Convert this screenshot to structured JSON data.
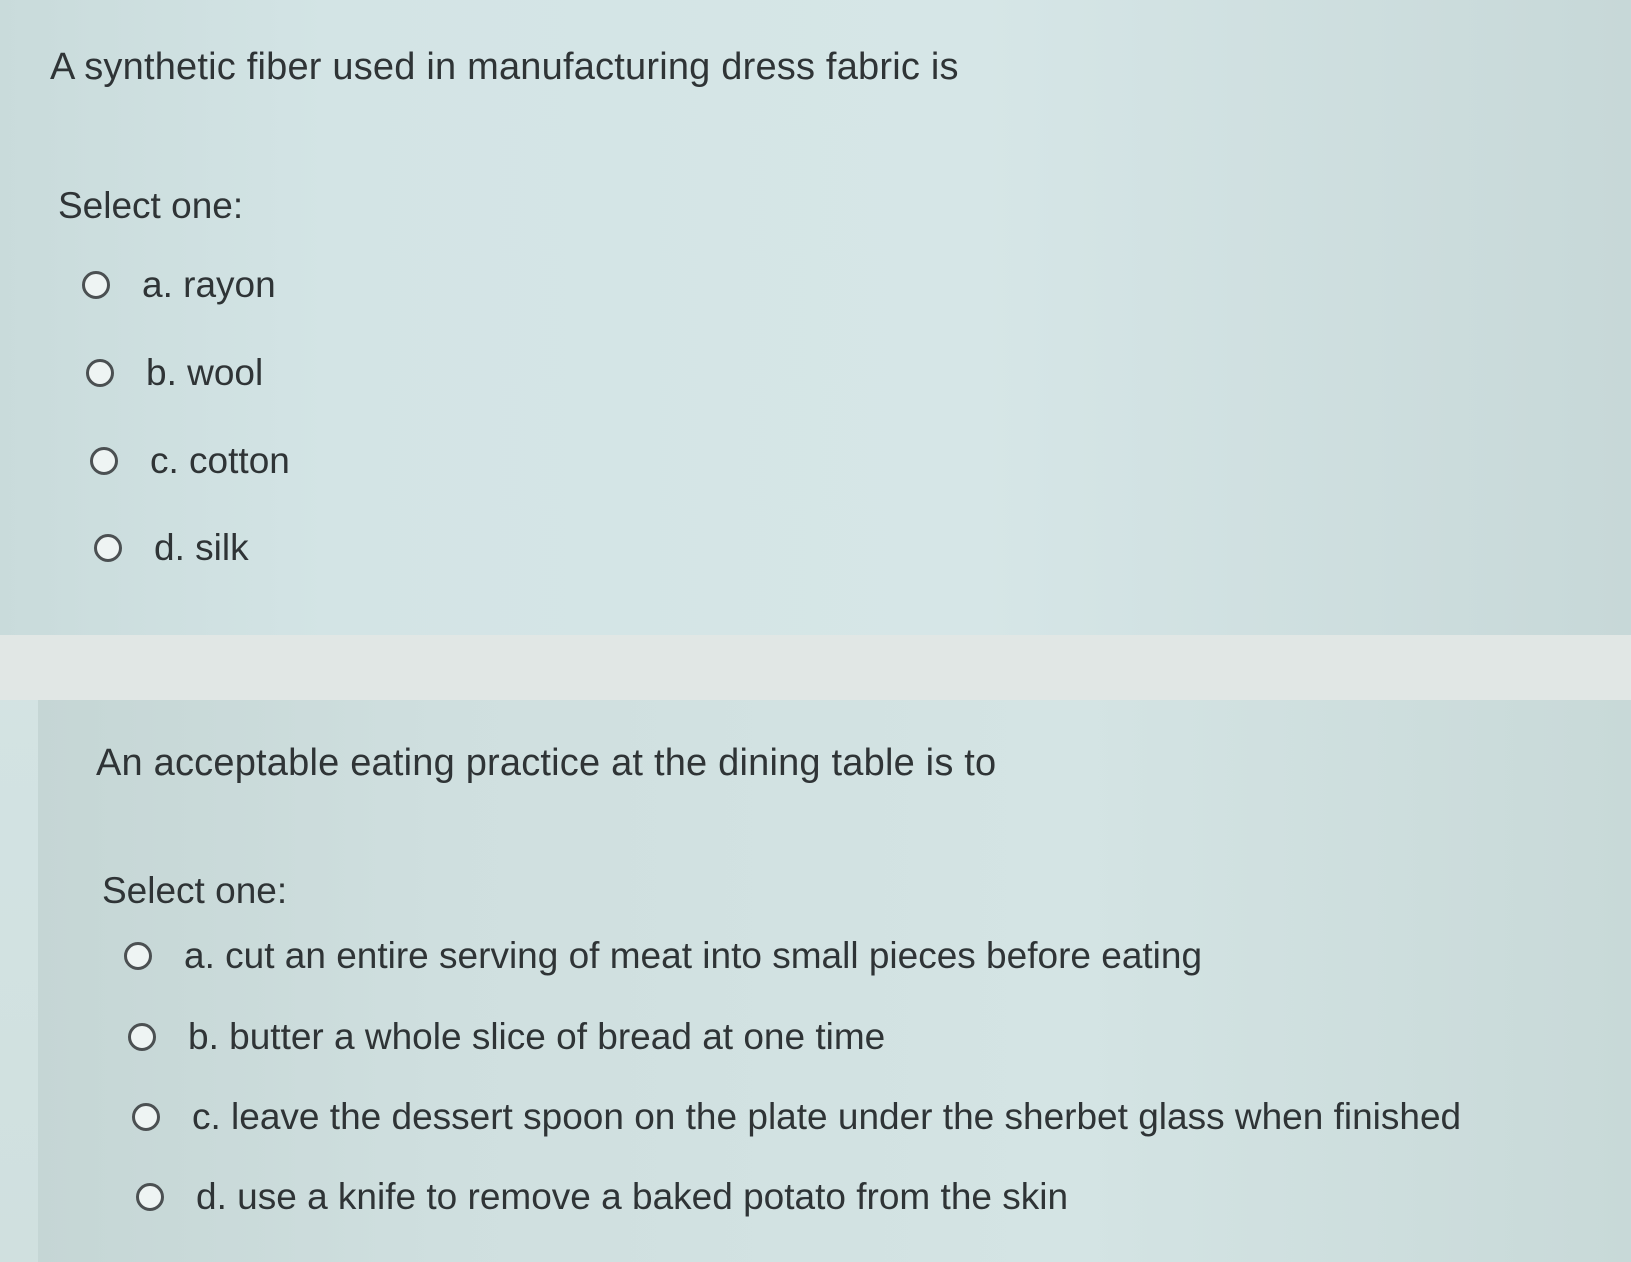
{
  "questions": [
    {
      "text": "A synthetic fiber used in manufacturing dress fabric is",
      "prompt": "Select one:",
      "options": [
        "a. rayon",
        "b. wool",
        "c. cotton",
        "d. silk"
      ]
    },
    {
      "text": "An acceptable eating practice at the dining table is to",
      "prompt": "Select one:",
      "options": [
        "a. cut an entire serving of meat into small pieces before eating",
        "b. butter a whole slice of bread at one time",
        "c. leave the dessert spoon on the plate under the sherbet glass when finished",
        "d. use a knife to remove a baked potato from the skin"
      ]
    }
  ]
}
